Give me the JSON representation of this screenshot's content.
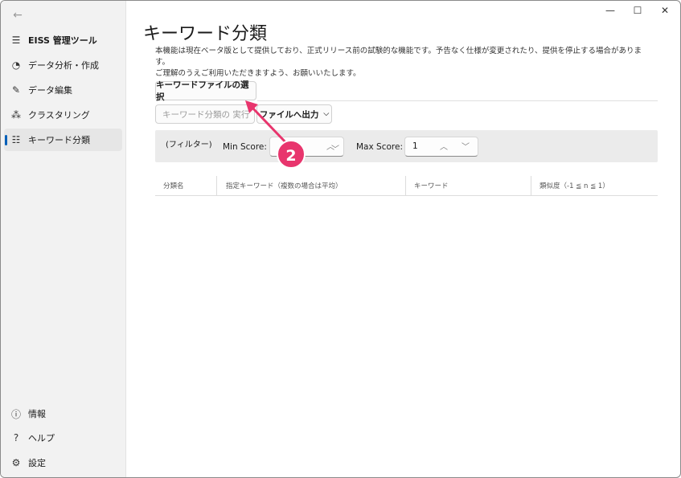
{
  "sidebar": {
    "app_title": "EISS 管理ツール",
    "items": [
      {
        "label": "データ分析・作成"
      },
      {
        "label": "データ編集"
      },
      {
        "label": "クラスタリング"
      },
      {
        "label": "キーワード分類"
      }
    ],
    "bottom": [
      {
        "label": "情報"
      },
      {
        "label": "ヘルプ"
      },
      {
        "label": "設定"
      }
    ]
  },
  "main": {
    "title": "キーワード分類",
    "description_line1": "本機能は現在ベータ版として提供しており、正式リリース前の試験的な機能です。予告なく仕様が変更されたり、提供を停止する場合があります。",
    "description_line2": "ご理解のうえご利用いただきますよう、お願いいたします。",
    "select_file_button": "キーワードファイルの選択",
    "run_button": "キーワード分類の 実行",
    "export_button": "ファイルへ出力",
    "filter": {
      "label": "(フィルター)",
      "min_label": "Min Score:",
      "max_label": "Max Score:",
      "max_value": "1"
    },
    "table": {
      "columns": [
        "分類名",
        "指定キーワード（複数の場合は平均）",
        "キーワード",
        "類似度（-1 ≦ n ≦ 1）"
      ]
    }
  },
  "annotation": {
    "step_number": "2",
    "color": "#e8356d"
  }
}
